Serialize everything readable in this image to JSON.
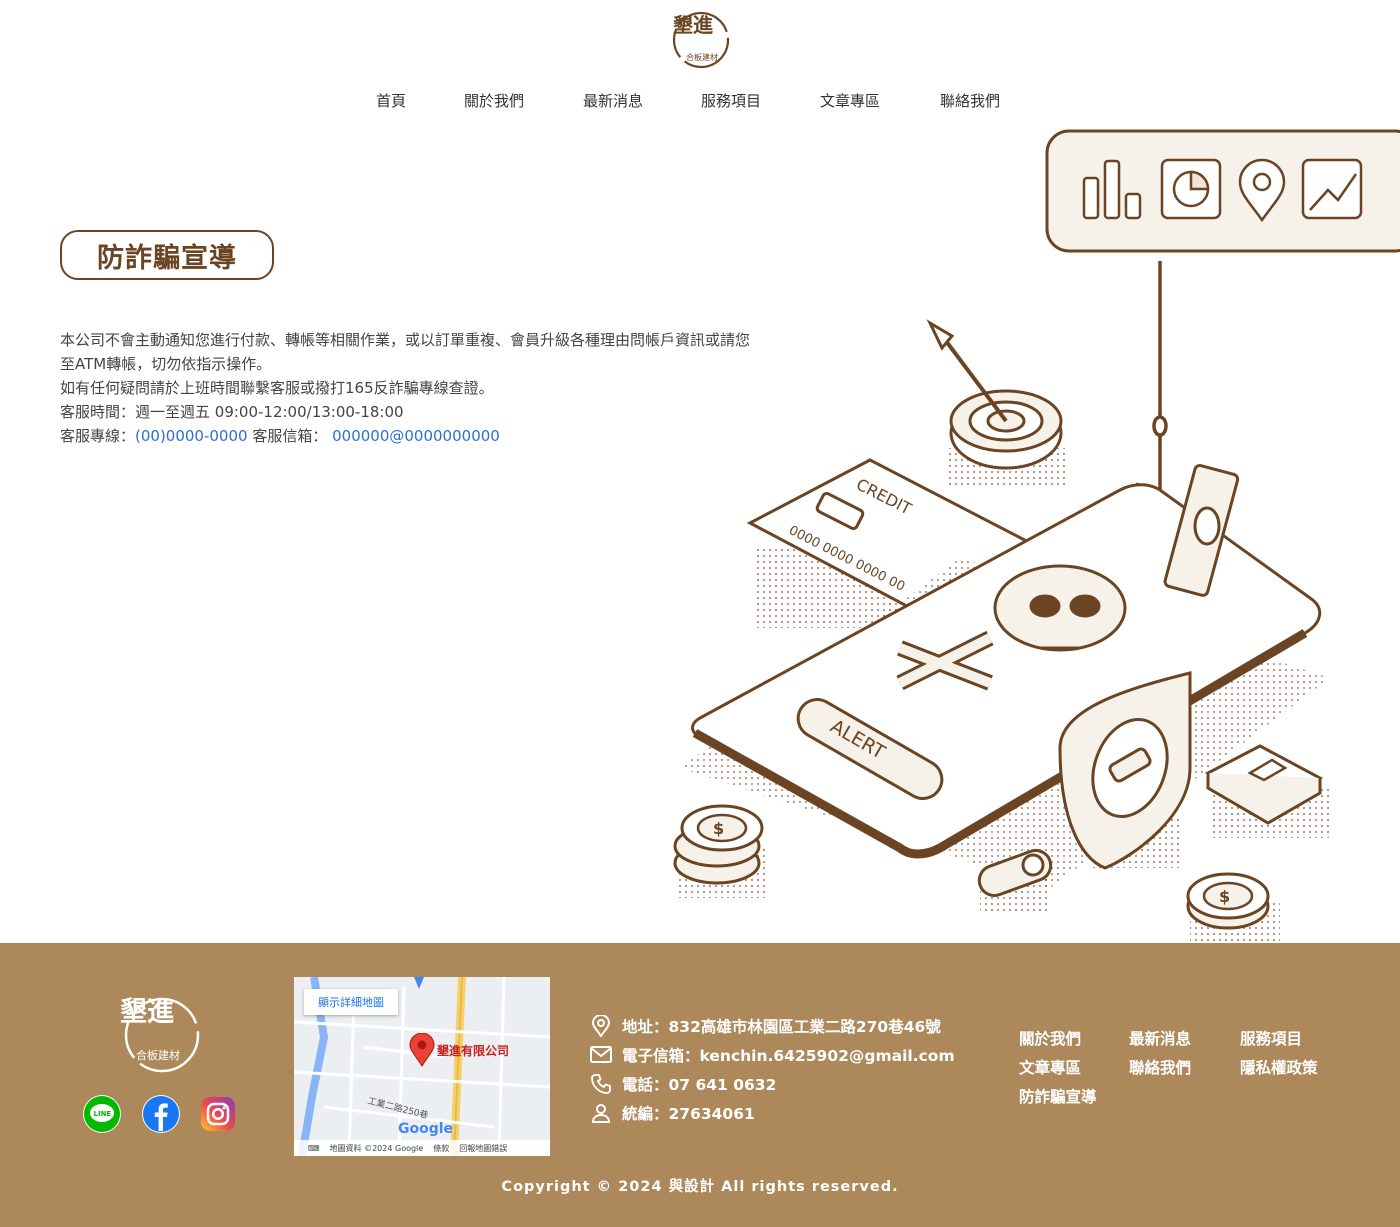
{
  "header": {
    "logo": {
      "name": "墾進",
      "sub": "合板建材"
    },
    "nav": [
      {
        "label": "首頁"
      },
      {
        "label": "關於我們"
      },
      {
        "label": "最新消息"
      },
      {
        "label": "服務項目"
      },
      {
        "label": "文章專區"
      },
      {
        "label": "聯絡我們"
      }
    ]
  },
  "main": {
    "title": "防詐騙宣導",
    "notice": {
      "line1": "本公司不會主動通知您進行付款、轉帳等相關作業，或以訂單重複、會員升級各種理由問帳戶資訊或請您",
      "line2": "至ATM轉帳，切勿依指示操作。",
      "line3": "如有任何疑問請於上班時間聯繫客服或撥打165反詐騙專線查證。",
      "line4": "客服時間：週一至週五 09:00-12:00/13:00-18:00",
      "line5_prefix": "客服專線：",
      "phone": "(00)0000-0000",
      "email_label": " 客服信箱： ",
      "email": "000000@0000000000"
    },
    "illustration": {
      "credit": "CREDIT",
      "card_number": "0000 0000 0000 00",
      "alert": "ALERT"
    }
  },
  "footer": {
    "logo": {
      "name": "墾進",
      "sub": "合板建材"
    },
    "social": [
      {
        "icon": "line-icon",
        "label": "LINE"
      },
      {
        "icon": "facebook-icon"
      },
      {
        "icon": "instagram-icon"
      }
    ],
    "map": {
      "button": "顯示詳細地圖",
      "place": "墾進有限公司",
      "road": "工業二路250巷",
      "google": "Google",
      "attribution": "地圖資料 ©2024 Google",
      "terms": "條款",
      "report": "回報地圖錯誤"
    },
    "contact": {
      "address": "地址：832高雄市林園區工業二路270巷46號",
      "email": "電子信箱：kenchin.6425902@gmail.com",
      "phone": "電話：07 641 0632",
      "tax_id": "統編：27634061"
    },
    "links": [
      {
        "label": "關於我們"
      },
      {
        "label": "最新消息"
      },
      {
        "label": "服務項目"
      },
      {
        "label": "文章專區"
      },
      {
        "label": "聯絡我們"
      },
      {
        "label": "隱私權政策"
      },
      {
        "label": "防詐騙宣導"
      }
    ],
    "copyright": "Copyright © 2024 與設計 All rights reserved."
  },
  "colors": {
    "brand_brown": "#6b4423",
    "footer_bg": "#ad885a",
    "link_blue": "#2b6fd1"
  }
}
